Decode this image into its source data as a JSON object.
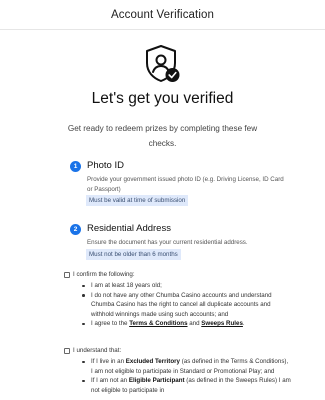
{
  "header": {
    "title": "Account Verification"
  },
  "hero": {
    "icon": "shield-user-check-icon",
    "title": "Let's get you verified",
    "subtitle": "Get ready to redeem prizes by completing these few checks."
  },
  "accent_color": "#1a73e8",
  "steps": [
    {
      "number": "1",
      "title": "Photo ID",
      "description": "Provide your government issued photo ID (e.g. Driving License, ID Card or Passport)",
      "badge": "Must be valid at time of submission"
    },
    {
      "number": "2",
      "title": "Residential Address",
      "description": "Ensure the document has your current residential address.",
      "badge": "Must not be older than 6 months"
    }
  ],
  "confirm": {
    "intro": "I confirm the following:",
    "items": [
      "I am at least 18 years old;",
      "I do not have any other Chumba Casino accounts and understand Chumba Casino has the right to cancel all duplicate accounts and withhold winnings made using such accounts; and"
    ],
    "agree_prefix": "I agree to the ",
    "terms_link": "Terms & Conditions",
    "and": " and ",
    "sweeps_link": "Sweeps Rules",
    "agree_suffix": "."
  },
  "understand": {
    "intro": "I understand that:",
    "item1_prefix": "If I live in an ",
    "item1_bold": "Excluded Territory",
    "item1_suffix": " (as defined in the Terms & Conditions), I am not eligible to participate in Standard or Promotional Play; and",
    "item2_prefix": "If I am not an ",
    "item2_bold": "Eligible Participant",
    "item2_suffix": " (as defined in the Sweeps Rules) I am not eligible to participate in"
  }
}
